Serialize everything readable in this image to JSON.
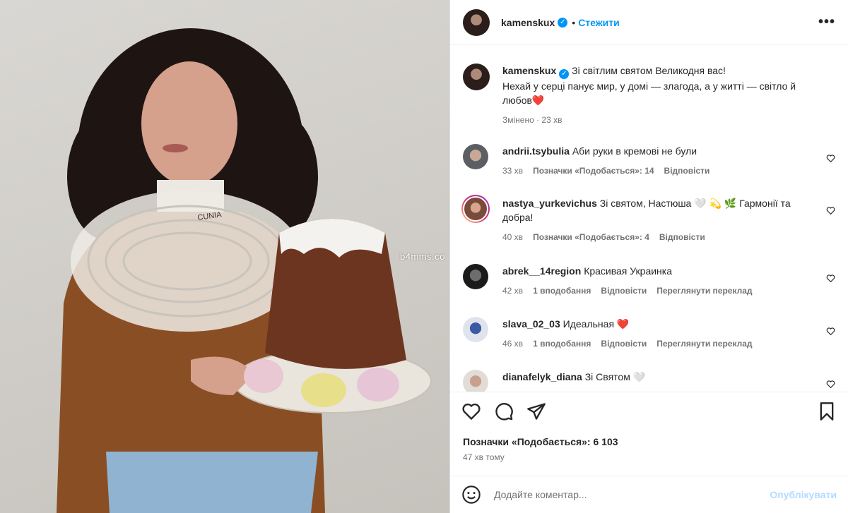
{
  "photo": {
    "watermark": "b4mms.co",
    "collar_text": "CUNIA"
  },
  "header": {
    "username": "kamenskux",
    "verified": "✓",
    "separator": "•",
    "follow_label": "Стежити",
    "more_label": "•••"
  },
  "caption": {
    "username": "kamenskux",
    "line1": "Зі світлим святом Великодня вас!",
    "line2": "Нехай у серці панує мир, у домі — злагода, а у житті — світло й любов❤️",
    "edited": "Змінено · 23 хв"
  },
  "comments": [
    {
      "username": "andrii.tsybulia",
      "text": "Аби руки в кремові не були",
      "time": "33 хв",
      "likes": "Позначки «Подобається»: 14",
      "reply": "Відповісти",
      "translate": ""
    },
    {
      "username": "nastya_yurkevichus",
      "text": "Зі святом, Настюша 🤍 💫 🌿 Гармонії та добра!",
      "time": "40 хв",
      "likes": "Позначки «Подобається»: 4",
      "reply": "Відповісти",
      "translate": ""
    },
    {
      "username": "abrek__14region",
      "text": "Красивая Украинка",
      "time": "42 хв",
      "likes": "1 вподобання",
      "reply": "Відповісти",
      "translate": "Переглянути переклад"
    },
    {
      "username": "slava_02_03",
      "text": "Идеальная ❤️",
      "time": "46 хв",
      "likes": "1 вподобання",
      "reply": "Відповісти",
      "translate": "Переглянути переклад"
    },
    {
      "username": "dianafelyk_diana",
      "text": "Зі Святом 🤍",
      "time": "",
      "likes": "",
      "reply": "",
      "translate": ""
    }
  ],
  "footer": {
    "likes": "Позначки «Подобається»: 6 103",
    "time": "47 хв тому",
    "comment_placeholder": "Додайте коментар...",
    "publish_label": "Опублікувати"
  },
  "colors": {
    "accent": "#0095f6",
    "publish_disabled": "#b3dbff",
    "muted": "#737373"
  }
}
